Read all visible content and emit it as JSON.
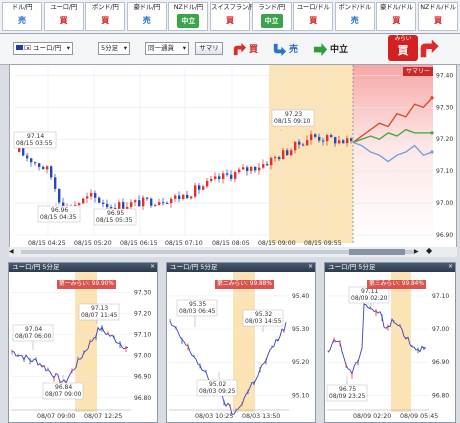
{
  "tabs": [
    {
      "label": "ドル/円",
      "signal": "売",
      "kind": "sell"
    },
    {
      "label": "ユーロ/円",
      "signal": "買",
      "kind": "buy"
    },
    {
      "label": "ポンド/円",
      "signal": "買",
      "kind": "buy"
    },
    {
      "label": "豪ドル/円",
      "signal": "売",
      "kind": "sell"
    },
    {
      "label": "NZドル/円",
      "signal": "中立",
      "kind": "neutral"
    },
    {
      "label": "スイスフラン/円",
      "signal": "買",
      "kind": "buy"
    },
    {
      "label": "ランド/円",
      "signal": "中立",
      "kind": "neutral"
    },
    {
      "label": "ユーロ/ドル",
      "signal": "買",
      "kind": "buy"
    },
    {
      "label": "ポンド/ドル",
      "signal": "売",
      "kind": "sell"
    },
    {
      "label": "豪ドル/ドル",
      "signal": "買",
      "kind": "buy"
    },
    {
      "label": "NZドル/ドル",
      "signal": "買",
      "kind": "buy"
    }
  ],
  "toolbar": {
    "pair": "ユーロ/円",
    "interval": "5分足",
    "mode": "同一通貨",
    "summary": "サマリ",
    "buy": "買",
    "sell": "売",
    "neutral": "中立",
    "prospect_top": "みらい",
    "prospect_bottom": "買"
  },
  "main": {
    "summary_label": "サマリー",
    "yticks": [
      "97.40",
      "97.30",
      "97.20",
      "97.10",
      "97.00",
      "96.90"
    ],
    "xticks": [
      "08/15 04:25",
      "08/15 05:20",
      "08/15 06:15",
      "08/15 07:10",
      "08/15 08:05",
      "08/15 09:00",
      "08/15 09:55"
    ],
    "annotations": [
      {
        "value": "97.14",
        "time": "08/15 03:55"
      },
      {
        "value": "96.96",
        "time": "08/15 04:35"
      },
      {
        "value": "96.95",
        "time": "08/15 05:35"
      },
      {
        "value": "97.23",
        "time": "08/15 09:10"
      }
    ]
  },
  "subcharts": [
    {
      "title": "ユーロ/円 5分足",
      "rank": "第一みらい: 99.90%",
      "yticks": [
        "97.30",
        "97.20",
        "97.10",
        "97.00",
        "96.90",
        "96.80"
      ],
      "xticks": [
        "08/07 09:00",
        "08/07 12:25"
      ],
      "ann": [
        {
          "value": "97.04",
          "time": "08/07 06:00"
        },
        {
          "value": "97.13",
          "time": "08/07 11:45"
        },
        {
          "value": "96.84",
          "time": "08/07 09:00"
        }
      ]
    },
    {
      "title": "ユーロ/円 5分足",
      "rank": "第二みらい: 99.88%",
      "yticks": [
        "95.40",
        "95.30",
        "95.20",
        "95.10"
      ],
      "xticks": [
        "08/03 10:25",
        "08/03 13:50"
      ],
      "ann": [
        {
          "value": "95.35",
          "time": "08/03 06:45"
        },
        {
          "value": "95.32",
          "time": "08/03 14:55"
        },
        {
          "value": "95.02",
          "time": "08/03 09:25"
        }
      ]
    },
    {
      "title": "ユーロ/円 5分足",
      "rank": "第三みらい: 99.84%",
      "yticks": [
        "97.10",
        "97.00",
        "96.90",
        "96.80"
      ],
      "xticks": [
        "08/09 02:20",
        "08/09 05:45"
      ],
      "ann": [
        {
          "value": "97.11",
          "time": "08/09 02:20"
        },
        {
          "value": "96.75",
          "time": "08/09 23:25"
        }
      ]
    }
  ],
  "chart_data": [
    {
      "type": "candlestick",
      "title": "ユーロ/円 5分足",
      "ylim": [
        96.9,
        97.42
      ],
      "x": [
        "08/15 04:25",
        "08/15 05:20",
        "08/15 06:15",
        "08/15 07:10",
        "08/15 08:05",
        "08/15 09:00",
        "08/15 09:55"
      ],
      "close_approx": [
        97.12,
        97.0,
        96.99,
        97.03,
        97.06,
        97.14,
        97.2
      ],
      "forecast_series": [
        {
          "name": "買",
          "end": 97.33
        },
        {
          "name": "中立",
          "end": 97.22
        },
        {
          "name": "売",
          "end": 97.16
        }
      ]
    }
  ]
}
